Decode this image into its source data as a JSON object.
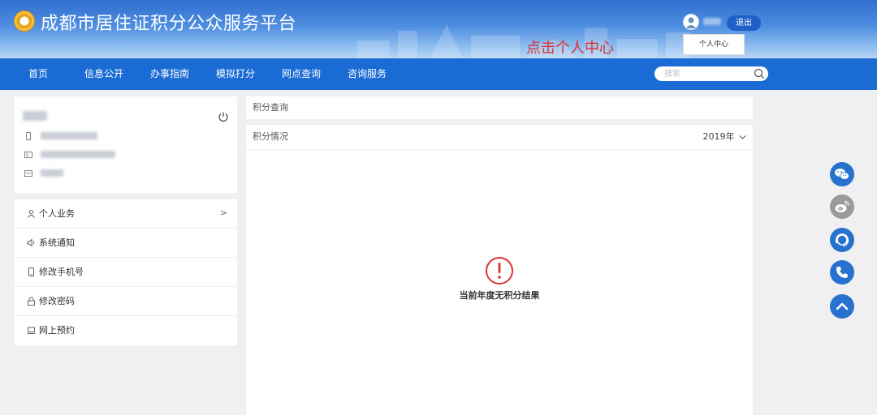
{
  "header": {
    "site_title": "成都市居住证积分公众服务平台",
    "logout_label": "退出",
    "dropdown_item": "个人中心",
    "annotation": "点击个人中心"
  },
  "nav": {
    "items": [
      "首页",
      "信息公开",
      "办事指南",
      "模拟打分",
      "网点查询",
      "咨询服务"
    ],
    "search_placeholder": "搜索"
  },
  "sidebar": {
    "menu": [
      {
        "label": "个人业务",
        "icon": "user-icon"
      },
      {
        "label": "系统通知",
        "icon": "speaker-icon"
      },
      {
        "label": "修改手机号",
        "icon": "phone-icon"
      },
      {
        "label": "修改密码",
        "icon": "lock-icon"
      },
      {
        "label": "网上预约",
        "icon": "laptop-icon"
      }
    ]
  },
  "main": {
    "query_title": "积分查询",
    "status_title": "积分情况",
    "year": "2019年",
    "empty_message": "当前年度无积分结果"
  },
  "float_icons": [
    "wechat-icon",
    "weibo-icon",
    "customer-service-icon",
    "phone-call-icon",
    "back-to-top-icon"
  ],
  "colors": {
    "nav_blue": "#1a6bd4",
    "float_blue": "#2872cf",
    "float_gray": "#9a9a9a",
    "alert_red": "#e03030"
  }
}
